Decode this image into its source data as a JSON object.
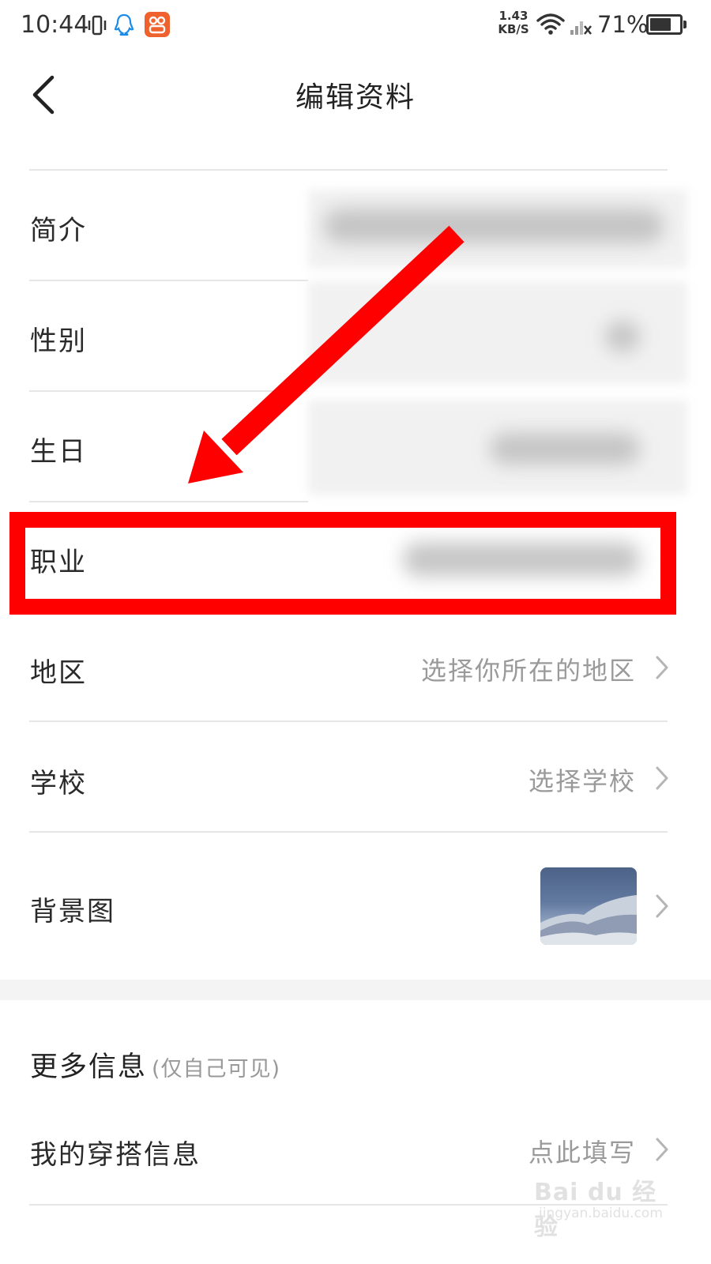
{
  "status_bar": {
    "time": "10:44",
    "net_speed_value": "1.43",
    "net_speed_unit": "KB/S",
    "battery_percent": "71%",
    "battery_level": 0.71,
    "app_icon_color": "#f0622d"
  },
  "header": {
    "title": "编辑资料",
    "back_icon": "chevron-left-icon"
  },
  "rows": {
    "bio": {
      "label": "简介",
      "value_visible": false
    },
    "gender": {
      "label": "性别",
      "value_visible": false
    },
    "birthday": {
      "label": "生日",
      "value_visible": false
    },
    "occupation": {
      "label": "职业",
      "value_visible": false
    },
    "region": {
      "label": "地区",
      "value": "选择你所在的地区"
    },
    "school": {
      "label": "学校",
      "value": "选择学校"
    },
    "background": {
      "label": "背景图",
      "thumbnail": "background-thumbnail"
    }
  },
  "more_info": {
    "title": "更多信息",
    "subtitle": "(仅自己可见)",
    "outfit": {
      "label": "我的穿搭信息",
      "value": "点此填写"
    }
  },
  "annotation": {
    "color": "#ff0000",
    "shape": "highlight box and arrow on 职业 row"
  },
  "watermark": {
    "logo": "Bai du 经验",
    "url": "jingyan.baidu.com"
  }
}
